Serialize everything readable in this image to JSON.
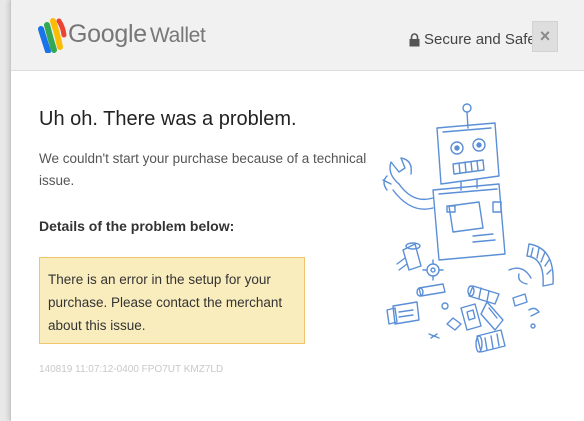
{
  "header": {
    "brand_google": "Google",
    "brand_product": "Wallet",
    "secure_label": "Secure and Safe",
    "close_label": "×"
  },
  "main": {
    "title": "Uh oh. There was a problem.",
    "description": "We couldn't start your purchase because of a technical issue.",
    "details_heading": "Details of the problem below:",
    "error_message": "There is an error in the setup for your purchase. Please contact the merchant about this issue.",
    "error_id": "140819 11:07:12-0400 FPO7UT KMZ7LD"
  },
  "icons": {
    "logo": "google-wallet-logo-icon",
    "lock": "lock-icon",
    "close": "close-icon",
    "illustration": "broken-robot-illustration"
  },
  "colors": {
    "header_bg": "#f1f1f1",
    "error_bg": "#f9edbe",
    "error_border": "#f0c36d",
    "sketch_blue": "#5b8fd6"
  }
}
